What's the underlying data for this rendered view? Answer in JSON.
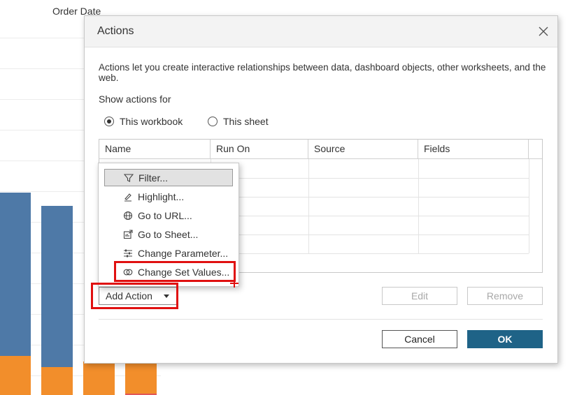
{
  "background": {
    "header_label": "Order Date",
    "bar_colors": {
      "blue": "#4e79a7",
      "orange": "#f28e2b",
      "pink": "#e15759"
    }
  },
  "dialog": {
    "title": "Actions",
    "description": "Actions let you create interactive relationships between data, dashboard objects, other worksheets, and the web.",
    "show_actions_for_label": "Show actions for",
    "radios": [
      {
        "label": "This workbook",
        "selected": true
      },
      {
        "label": "This sheet",
        "selected": false
      }
    ],
    "table": {
      "columns": [
        "Name",
        "Run On",
        "Source",
        "Fields"
      ],
      "rows": []
    },
    "add_action_label": "Add Action",
    "edit_label": "Edit",
    "remove_label": "Remove",
    "cancel_label": "Cancel",
    "ok_label": "OK",
    "accent_color": "#1f6387"
  },
  "menu": {
    "items": [
      {
        "label": "Filter...",
        "icon": "filter-icon",
        "active": true
      },
      {
        "label": "Highlight...",
        "icon": "highlight-icon",
        "active": false
      },
      {
        "label": "Go to URL...",
        "icon": "globe-icon",
        "active": false
      },
      {
        "label": "Go to Sheet...",
        "icon": "sheet-icon",
        "active": false
      },
      {
        "label": "Change Parameter...",
        "icon": "sliders-icon",
        "active": false
      },
      {
        "label": "Change Set Values...",
        "icon": "set-icon",
        "active": false
      }
    ]
  },
  "annotations": {
    "highlight_color": "#e01010"
  }
}
